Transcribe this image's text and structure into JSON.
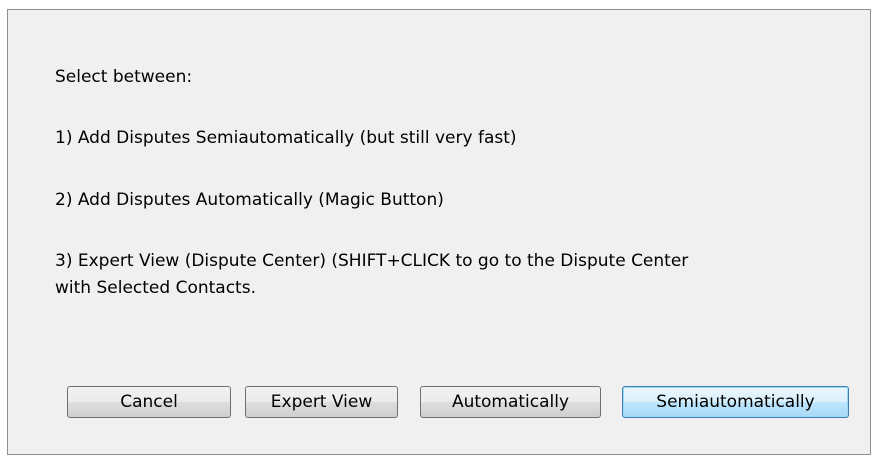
{
  "message": {
    "line1": "Select between:",
    "line2": "1) Add Disputes Semiautomatically (but still very fast)",
    "line3": "2) Add Disputes Automatically (Magic Button)",
    "line4a": "3) Expert View (Dispute Center)  (SHIFT+CLICK to go to the Dispute Center",
    "line4b": "with Selected Contacts."
  },
  "buttons": {
    "cancel": "Cancel",
    "expert_view": "Expert View",
    "automatically": "Automatically",
    "semiautomatically": "Semiautomatically"
  }
}
